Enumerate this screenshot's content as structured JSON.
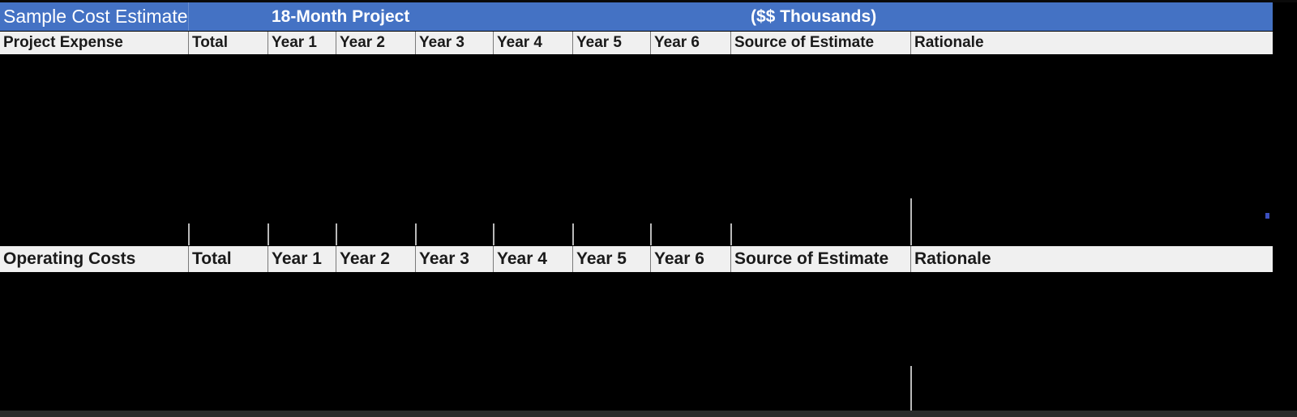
{
  "title_bar": {
    "title": "Sample  Cost Estimate",
    "project_duration": "18-Month Project",
    "units": "($$ Thousands)",
    "background_color": "#4472C4",
    "text_color": "#FFFFFF"
  },
  "tables": [
    {
      "id": "project-expense",
      "headers": [
        "Project Expense",
        "Total",
        "Year 1",
        "Year 2",
        "Year 3",
        "Year 4",
        "Year 5",
        "Year 6",
        "Source of Estimate",
        "Rationale"
      ],
      "rows": []
    },
    {
      "id": "operating-costs",
      "headers": [
        "Operating Costs",
        "Total",
        "Year 1",
        "Year 2",
        "Year 3",
        "Year 4",
        "Year 5",
        "Year 6",
        "Source of Estimate",
        "Rationale"
      ],
      "rows": []
    }
  ],
  "colors": {
    "header_fill": "#F0F0F0",
    "header_text": "#1A1A1A",
    "body_fill": "#000000",
    "gridline": "#B9B9B9",
    "accent_blue": "#4472C4"
  }
}
